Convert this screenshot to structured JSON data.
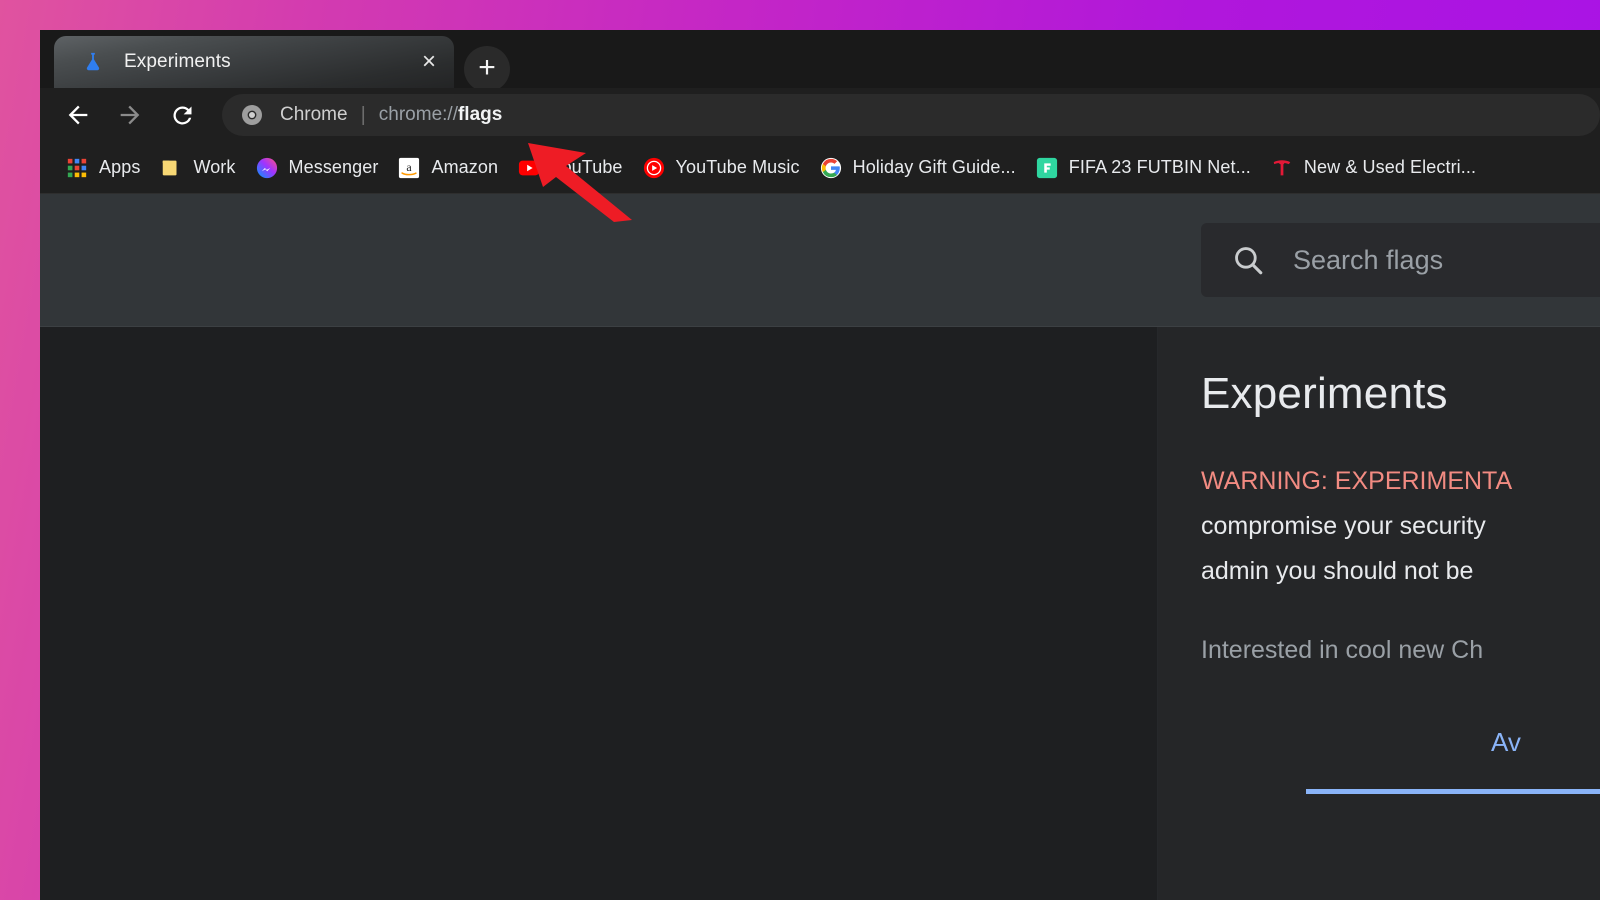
{
  "window": {
    "frame_gradient_from": "#e0539f",
    "frame_gradient_to": "#a812e8"
  },
  "tabstrip": {
    "active_tab": {
      "title": "Experiments",
      "favicon": "flask-icon",
      "close_label": "×"
    },
    "new_tab_label": "+"
  },
  "toolbar": {
    "back_label": "←",
    "forward_label": "→",
    "reload_label": "⟳",
    "omnibox": {
      "site_icon": "chrome-logo-icon",
      "chrome_label": "Chrome",
      "separator": "|",
      "url_prefix": "chrome://",
      "url_bold": "flags"
    }
  },
  "bookmarks": [
    {
      "label": "Apps",
      "icon": "apps-grid-icon"
    },
    {
      "label": "Work",
      "icon": "folder-icon"
    },
    {
      "label": "Messenger",
      "icon": "messenger-icon"
    },
    {
      "label": "Amazon",
      "icon": "amazon-icon"
    },
    {
      "label": "YouTube",
      "icon": "youtube-icon"
    },
    {
      "label": "YouTube Music",
      "icon": "youtube-music-icon"
    },
    {
      "label": "Holiday Gift Guide...",
      "icon": "google-icon"
    },
    {
      "label": "FIFA 23 FUTBIN Net...",
      "icon": "futbin-icon"
    },
    {
      "label": "New & Used Electri...",
      "icon": "tesla-icon"
    }
  ],
  "flags_page": {
    "search": {
      "placeholder": "Search flags",
      "value": "",
      "icon": "search-icon"
    },
    "title": "Experiments",
    "warning_head": "WARNING: EXPERIMENTA",
    "warning_line2": "compromise your security",
    "warning_line3": "admin you should not be",
    "interested_text": "Interested in cool new Ch",
    "tab_available": "Av",
    "accent_color": "#8ab4f8",
    "warning_color": "#f28b82"
  },
  "cursor": {
    "type": "arrow-pointer",
    "color": "#ee1c25"
  }
}
